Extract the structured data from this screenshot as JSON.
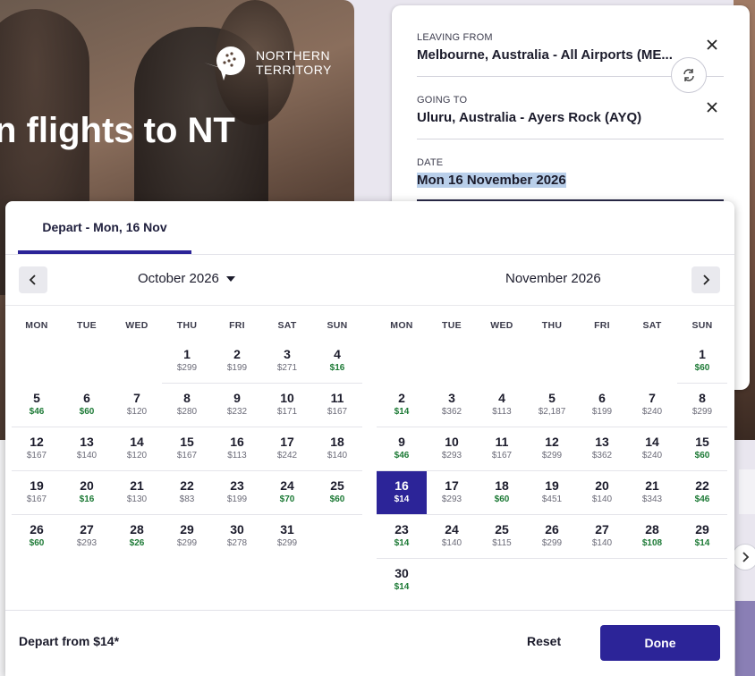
{
  "hero": {
    "title": "n flights to NT",
    "logo_line1": "NORTHERN",
    "logo_line2": "TERRITORY"
  },
  "search": {
    "leaving_label": "LEAVING FROM",
    "leaving_value": "Melbourne, Australia - All Airports (ME...",
    "going_label": "GOING TO",
    "going_value": "Uluru, Australia - Ayers Rock (AYQ)",
    "date_label": "DATE",
    "date_value": "Mon 16 November 2026"
  },
  "calendar": {
    "tab_label": "Depart - Mon, 16 Nov",
    "left_month": "October 2026",
    "right_month": "November 2026",
    "weekdays": [
      "MON",
      "TUE",
      "WED",
      "THU",
      "FRI",
      "SAT",
      "SUN"
    ],
    "selected_day": 16,
    "october": {
      "offset": 3,
      "days": [
        {
          "d": "1",
          "p": "$299",
          "cheap": false
        },
        {
          "d": "2",
          "p": "$199",
          "cheap": false
        },
        {
          "d": "3",
          "p": "$271",
          "cheap": false
        },
        {
          "d": "4",
          "p": "$16",
          "cheap": true
        },
        {
          "d": "5",
          "p": "$46",
          "cheap": true
        },
        {
          "d": "6",
          "p": "$60",
          "cheap": true
        },
        {
          "d": "7",
          "p": "$120",
          "cheap": false
        },
        {
          "d": "8",
          "p": "$280",
          "cheap": false
        },
        {
          "d": "9",
          "p": "$232",
          "cheap": false
        },
        {
          "d": "10",
          "p": "$171",
          "cheap": false
        },
        {
          "d": "11",
          "p": "$167",
          "cheap": false
        },
        {
          "d": "12",
          "p": "$167",
          "cheap": false
        },
        {
          "d": "13",
          "p": "$140",
          "cheap": false
        },
        {
          "d": "14",
          "p": "$120",
          "cheap": false
        },
        {
          "d": "15",
          "p": "$167",
          "cheap": false
        },
        {
          "d": "16",
          "p": "$113",
          "cheap": false
        },
        {
          "d": "17",
          "p": "$242",
          "cheap": false
        },
        {
          "d": "18",
          "p": "$140",
          "cheap": false
        },
        {
          "d": "19",
          "p": "$167",
          "cheap": false
        },
        {
          "d": "20",
          "p": "$16",
          "cheap": true
        },
        {
          "d": "21",
          "p": "$130",
          "cheap": false
        },
        {
          "d": "22",
          "p": "$83",
          "cheap": false
        },
        {
          "d": "23",
          "p": "$199",
          "cheap": false
        },
        {
          "d": "24",
          "p": "$70",
          "cheap": true
        },
        {
          "d": "25",
          "p": "$60",
          "cheap": true
        },
        {
          "d": "26",
          "p": "$60",
          "cheap": true
        },
        {
          "d": "27",
          "p": "$293",
          "cheap": false
        },
        {
          "d": "28",
          "p": "$26",
          "cheap": true
        },
        {
          "d": "29",
          "p": "$299",
          "cheap": false
        },
        {
          "d": "30",
          "p": "$278",
          "cheap": false
        },
        {
          "d": "31",
          "p": "$299",
          "cheap": false
        }
      ]
    },
    "november": {
      "offset": 6,
      "days": [
        {
          "d": "1",
          "p": "$60",
          "cheap": true
        },
        {
          "d": "2",
          "p": "$14",
          "cheap": true
        },
        {
          "d": "3",
          "p": "$362",
          "cheap": false
        },
        {
          "d": "4",
          "p": "$113",
          "cheap": false
        },
        {
          "d": "5",
          "p": "$2,187",
          "cheap": false
        },
        {
          "d": "6",
          "p": "$199",
          "cheap": false
        },
        {
          "d": "7",
          "p": "$240",
          "cheap": false
        },
        {
          "d": "8",
          "p": "$299",
          "cheap": false
        },
        {
          "d": "9",
          "p": "$46",
          "cheap": true
        },
        {
          "d": "10",
          "p": "$293",
          "cheap": false
        },
        {
          "d": "11",
          "p": "$167",
          "cheap": false
        },
        {
          "d": "12",
          "p": "$299",
          "cheap": false
        },
        {
          "d": "13",
          "p": "$362",
          "cheap": false
        },
        {
          "d": "14",
          "p": "$240",
          "cheap": false
        },
        {
          "d": "15",
          "p": "$60",
          "cheap": true
        },
        {
          "d": "16",
          "p": "$14",
          "cheap": true
        },
        {
          "d": "17",
          "p": "$293",
          "cheap": false
        },
        {
          "d": "18",
          "p": "$60",
          "cheap": true
        },
        {
          "d": "19",
          "p": "$451",
          "cheap": false
        },
        {
          "d": "20",
          "p": "$140",
          "cheap": false
        },
        {
          "d": "21",
          "p": "$343",
          "cheap": false
        },
        {
          "d": "22",
          "p": "$46",
          "cheap": true
        },
        {
          "d": "23",
          "p": "$14",
          "cheap": true
        },
        {
          "d": "24",
          "p": "$140",
          "cheap": false
        },
        {
          "d": "25",
          "p": "$115",
          "cheap": false
        },
        {
          "d": "26",
          "p": "$299",
          "cheap": false
        },
        {
          "d": "27",
          "p": "$140",
          "cheap": false
        },
        {
          "d": "28",
          "p": "$108",
          "cheap": true
        },
        {
          "d": "29",
          "p": "$14",
          "cheap": true
        },
        {
          "d": "30",
          "p": "$14",
          "cheap": true
        }
      ]
    }
  },
  "footer": {
    "depart_from": "Depart from $14*",
    "reset_label": "Reset",
    "done_label": "Done"
  },
  "colors": {
    "accent": "#2c2498",
    "cheap_price": "#1d7a36",
    "regular_price": "#6b6b78"
  },
  "icons": {
    "close": "close-icon",
    "swap": "swap-icon",
    "prev": "chevron-left-icon",
    "next": "chevron-right-icon",
    "dropdown": "caret-down-icon"
  }
}
